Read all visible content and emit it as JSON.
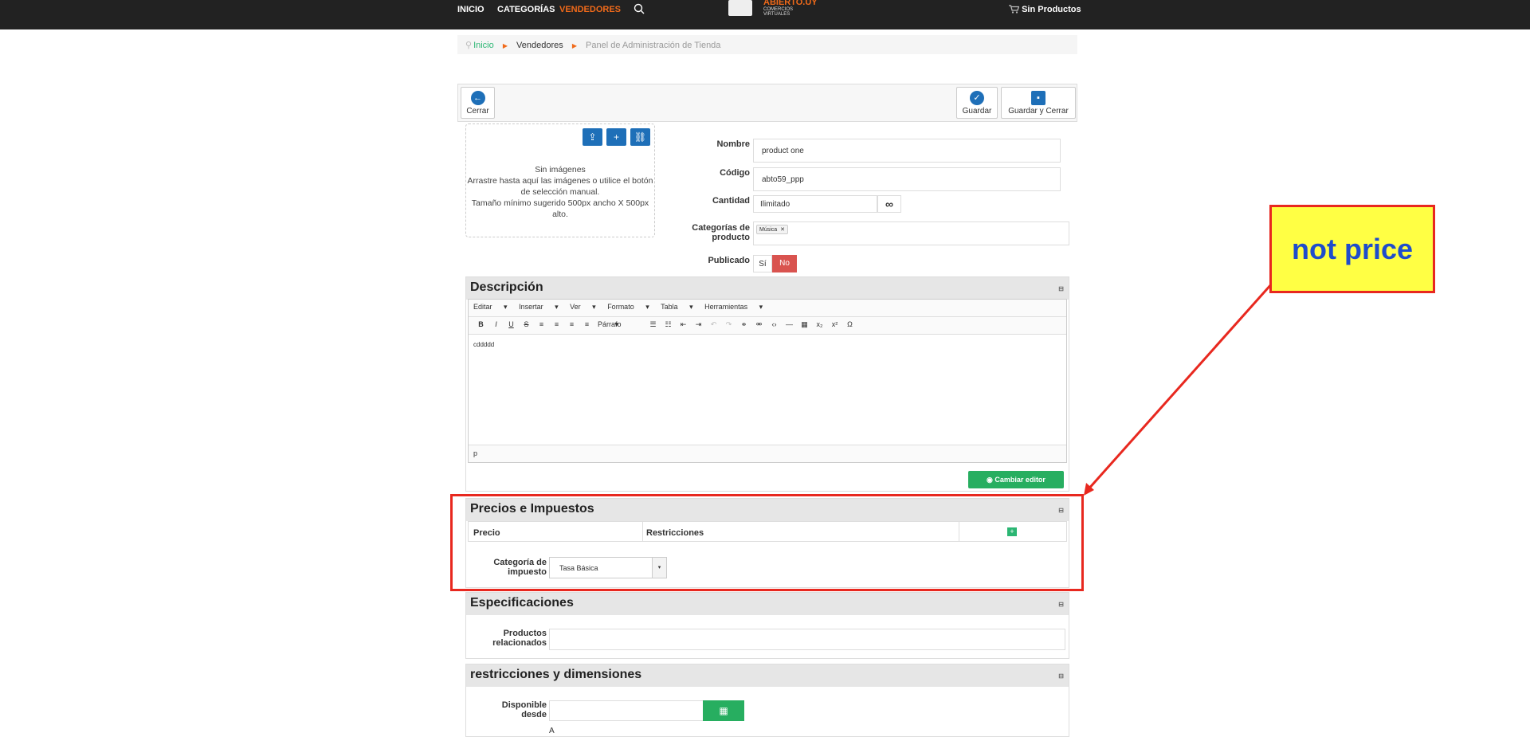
{
  "nav": {
    "inicio": "INICIO",
    "categorias": "CATEGORÍAS",
    "vendedores": "VENDEDORES",
    "logo_main": "ABIERTO.UY",
    "logo_sub": "COMERCIOS VIRTUALES",
    "cart": "Sin Productos",
    "icons": {
      "search": "search-icon",
      "cart": "cart-icon"
    }
  },
  "breadcrumb": {
    "home": "Inicio",
    "vendors": "Vendedores",
    "current": "Panel de Administración de Tienda"
  },
  "toolbar": {
    "close": "Cerrar",
    "save": "Guardar",
    "save_close": "Guardar y Cerrar"
  },
  "images": {
    "line1": "Sin imágenes",
    "line2": "Arrastre hasta aquí las imágenes o utilice el botón de selección manual.",
    "line3": "Tamaño mínimo sugerido 500px ancho X 500px alto."
  },
  "form": {
    "nombre_label": "Nombre",
    "nombre_value": "product one",
    "codigo_label": "Código",
    "codigo_value": "abto59_ppp",
    "cantidad_label": "Cantidad",
    "cantidad_value": "Ilimitado",
    "categorias_label_1": "Categorías de",
    "categorias_label_2": "producto",
    "category_tag": "Música",
    "publicado_label": "Publicado",
    "publicado_yes": "Sí",
    "publicado_no": "No"
  },
  "descripcion": {
    "title": "Descripción",
    "menu": [
      "Editar",
      "Insertar",
      "Ver",
      "Formato",
      "Tabla",
      "Herramientas"
    ],
    "paragraph": "Párrafo",
    "content": "cddddd",
    "status": "p",
    "switch_editor": "Cambiar editor"
  },
  "precios": {
    "title": "Precios e Impuestos",
    "col_precio": "Precio",
    "col_restricciones": "Restricciones",
    "tax_label_1": "Categoría de",
    "tax_label_2": "impuesto",
    "tax_value": "Tasa Básica"
  },
  "especificaciones": {
    "title": "Especificaciones",
    "related_label_1": "Productos",
    "related_label_2": "relacionados"
  },
  "restricciones": {
    "title": "restricciones y dimensiones",
    "disponible_label": "Disponible desde",
    "partial": "A"
  },
  "annotation": {
    "text": "not price",
    "color_fill": "#ffff44",
    "color_border": "#e8281f",
    "color_text": "#1f4ccc"
  }
}
